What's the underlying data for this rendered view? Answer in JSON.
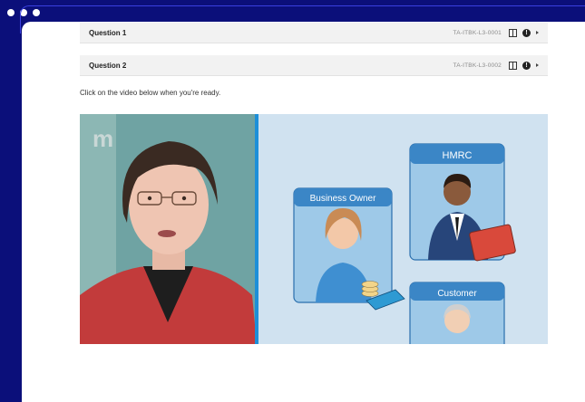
{
  "window": {
    "controls": [
      "dot",
      "dot",
      "dot"
    ]
  },
  "questions": [
    {
      "title": "Question 1",
      "code": "TA-ITBK-L3-0001"
    },
    {
      "title": "Question 2",
      "code": "TA-ITBK-L3-0002"
    }
  ],
  "instruction": "Click on the video below when you're ready.",
  "video": {
    "watermark": "m",
    "cards": {
      "business_owner": "Business Owner",
      "hmrc": "HMRC",
      "customer": "Customer"
    },
    "colors": {
      "scene_background": "#d0e2f0",
      "card_header": "#3b86c6",
      "divider": "#1d8fd8",
      "presenter_background": "#6fa3a3"
    }
  }
}
